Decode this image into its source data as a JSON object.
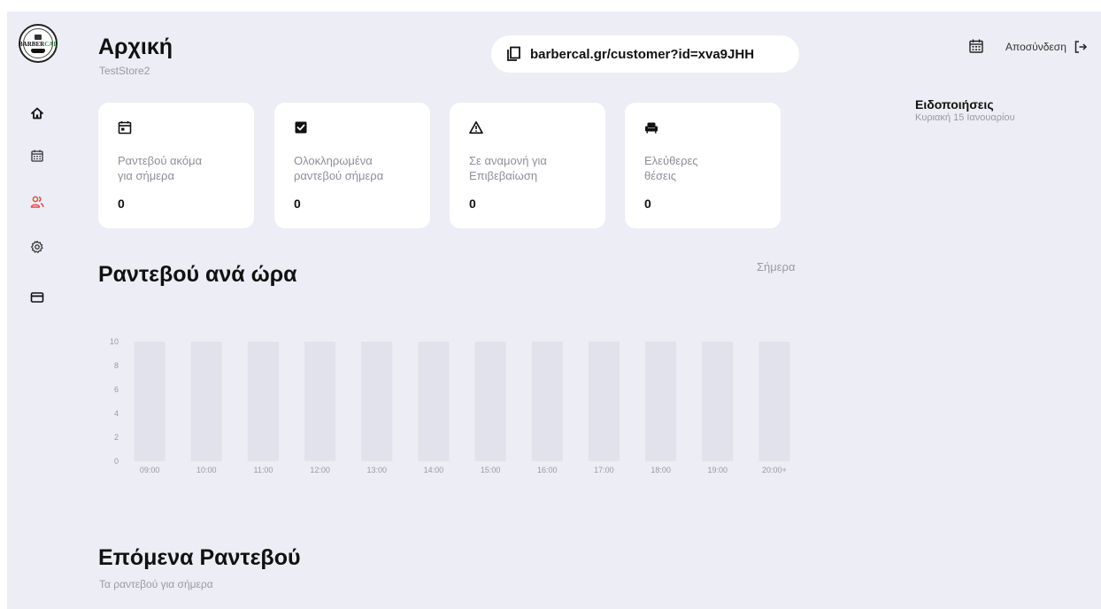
{
  "brand": {
    "logo_text_main": "BARBER",
    "logo_text_accent": "CAL",
    "accent_color": "#2c8c3c"
  },
  "sidebar": {
    "items": [
      {
        "name": "home-icon",
        "active": false
      },
      {
        "name": "calendar-icon",
        "active": false
      },
      {
        "name": "users-icon",
        "active": true
      },
      {
        "name": "gear-icon",
        "active": false
      },
      {
        "name": "credit-card-icon",
        "active": false
      }
    ],
    "active_color": "#e5484d"
  },
  "header": {
    "title": "Αρχική",
    "store_name": "TestStore2",
    "share_url": "barbercal.gr/customer?id=xva9JHH",
    "logout_label": "Αποσύνδεση"
  },
  "notifications": {
    "title": "Ειδοποιήσεις",
    "date": "Κυριακή 15 Ιανουαρίου"
  },
  "stats": [
    {
      "icon": "calendar-day-icon",
      "label": "Ραντεβού ακόμα\nγια σήμερα",
      "value": "0"
    },
    {
      "icon": "checkbox-checked-icon",
      "label": "Ολοκληρωμένα\nραντεβού σήμερα",
      "value": "0"
    },
    {
      "icon": "warning-icon",
      "label": "Σε αναμονή για\nΕπιβεβαίωση",
      "value": "0"
    },
    {
      "icon": "armchair-icon",
      "label": "Ελεύθερες\n θέσεις",
      "value": "0"
    }
  ],
  "chart_section": {
    "title": "Ραντεβού ανά ώρα",
    "filter": "Σήμερα"
  },
  "chart_data": {
    "type": "bar",
    "title": "Ραντεβού ανά ώρα",
    "xlabel": "",
    "ylabel": "",
    "categories": [
      "09:00",
      "10:00",
      "11:00",
      "12:00",
      "13:00",
      "14:00",
      "15:00",
      "16:00",
      "17:00",
      "18:00",
      "19:00",
      "20:00+"
    ],
    "values": [
      0,
      0,
      0,
      0,
      0,
      0,
      0,
      0,
      0,
      0,
      0,
      0
    ],
    "yticks": [
      0,
      2,
      4,
      6,
      8,
      10
    ],
    "ylim": [
      0,
      10
    ],
    "background_bars": true,
    "bar_track_color": "#e2e2ec",
    "bar_color": "#6c63ff",
    "grid": false,
    "legend": "none"
  },
  "upcoming": {
    "title": "Επόμενα Ραντεβού",
    "subtitle": "Τα ραντεβού για σήμερα"
  }
}
